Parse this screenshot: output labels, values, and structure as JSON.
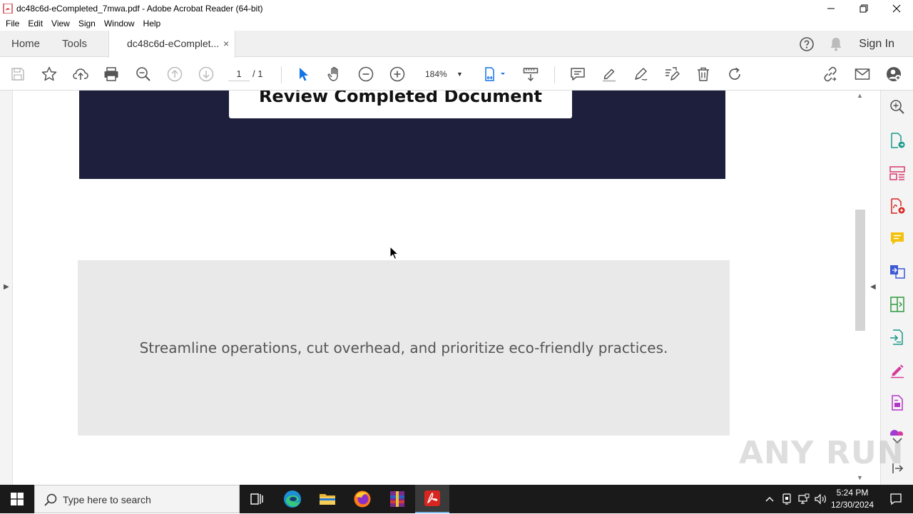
{
  "window": {
    "title": "dc48c6d-eCompleted_7mwa.pdf - Adobe Acrobat Reader (64-bit)",
    "controls": [
      "minimize-icon",
      "maximize-icon",
      "close-icon"
    ]
  },
  "menu": [
    "File",
    "Edit",
    "View",
    "Sign",
    "Window",
    "Help"
  ],
  "tabs": {
    "home": "Home",
    "tools": "Tools",
    "document": "dc48c6d-eComplet...",
    "close_glyph": "×",
    "sign_in": "Sign In"
  },
  "toolbar": {
    "page_current": "1",
    "page_total": "/ 1",
    "zoom": "184%"
  },
  "document": {
    "banner_heading": "Review Completed Document",
    "message": "Streamline operations, cut overhead, and prioritize eco-friendly practices.",
    "banner_color": "#1d1f3d",
    "box_color": "#e9e9e9"
  },
  "right_pane_tools": [
    "zoom-search-icon",
    "export-pdf-icon",
    "organize-pages-icon",
    "create-pdf-icon",
    "comment-icon",
    "combine-files-icon",
    "compress-icon",
    "send-for-signature-icon",
    "fill-sign-icon",
    "edit-pdf-icon",
    "more-tools-icon"
  ],
  "watermark": "ANY RUN",
  "taskbar": {
    "search_placeholder": "Type here to search",
    "time": "5:24 PM",
    "date": "12/30/2024"
  },
  "colors": {
    "accent_blue": "#1473e6",
    "acrobat_red": "#d7251f"
  }
}
